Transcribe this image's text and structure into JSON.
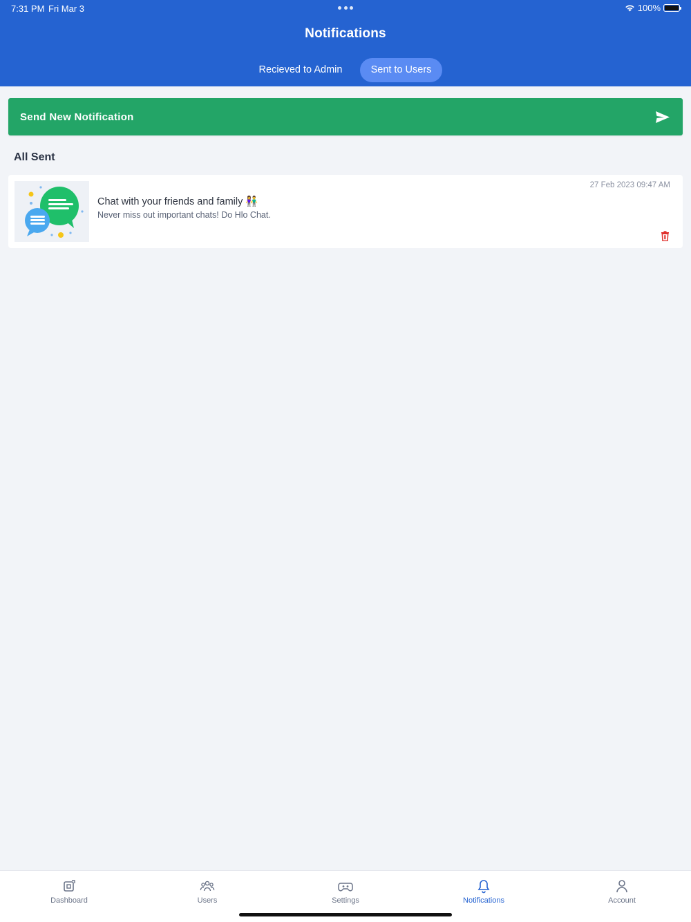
{
  "status_bar": {
    "time": "7:31 PM",
    "date": "Fri Mar 3",
    "battery": "100%"
  },
  "header": {
    "title": "Notifications",
    "tabs": [
      {
        "label": "Recieved to Admin",
        "active": false
      },
      {
        "label": "Sent to Users",
        "active": true
      }
    ]
  },
  "send_button": {
    "label": "Send New Notification",
    "icon": "send-icon"
  },
  "section": {
    "title": "All Sent"
  },
  "notifications": [
    {
      "title": "Chat with your friends and family 👫",
      "subtitle": "Never miss out important chats! Do Hlo Chat.",
      "date": "27 Feb 2023",
      "time": "09:47 AM",
      "thumbnail_icon": "chat-bubbles-illustration",
      "delete_icon": "trash-icon"
    }
  ],
  "bottom_nav": [
    {
      "label": "Dashboard",
      "icon": "dashboard-icon",
      "active": false
    },
    {
      "label": "Users",
      "icon": "users-icon",
      "active": false
    },
    {
      "label": "Settings",
      "icon": "gamepad-icon",
      "active": false
    },
    {
      "label": "Notifications",
      "icon": "bell-icon",
      "active": true
    },
    {
      "label": "Account",
      "icon": "user-icon",
      "active": false
    }
  ],
  "colors": {
    "header": "#2563d1",
    "active_tab": "#5a8bf3",
    "send_button": "#23a567",
    "delete": "#e0302c",
    "background": "#f2f4f8"
  }
}
